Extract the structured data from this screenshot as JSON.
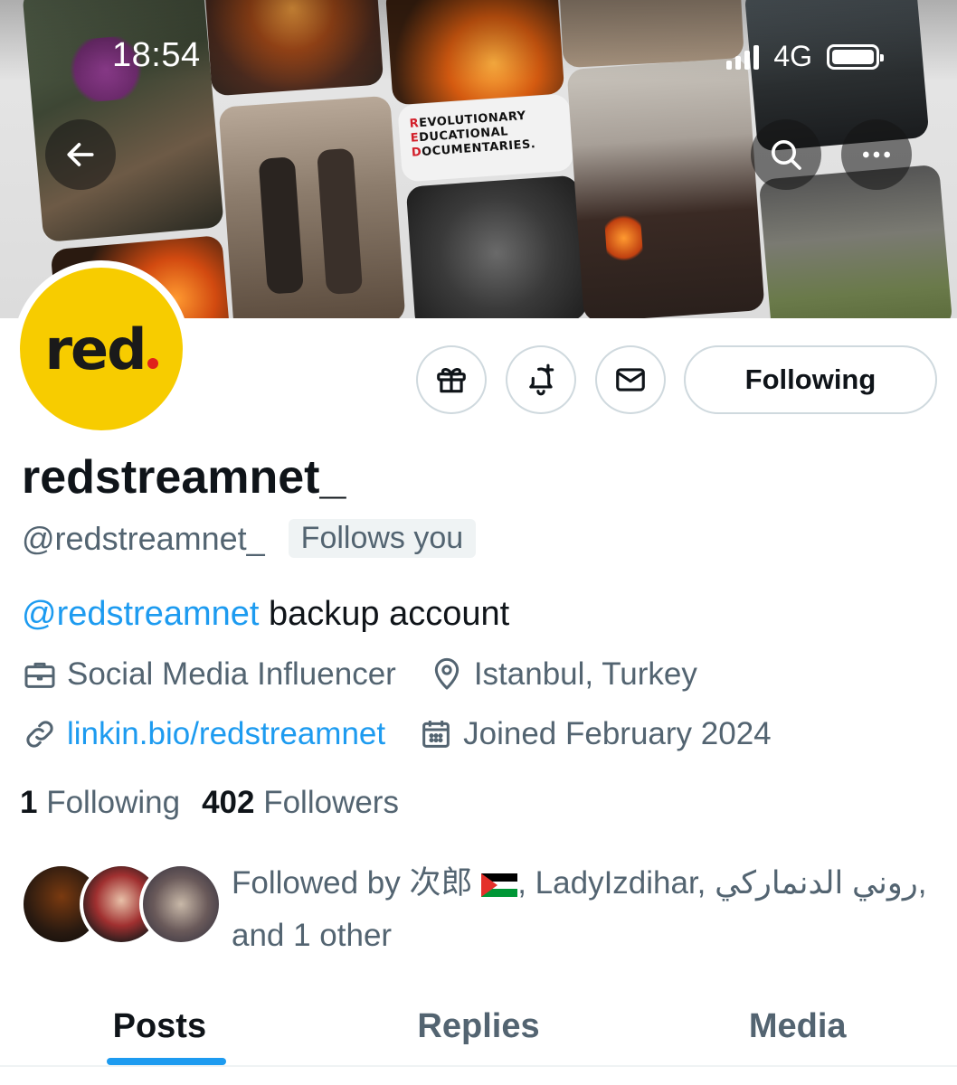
{
  "status_bar": {
    "time": "18:54",
    "network": "4G"
  },
  "banner": {
    "doc_line1_first": "R",
    "doc_line1_rest": "EVOLUTIONARY",
    "doc_line2_first": "E",
    "doc_line2_rest": "DUCATIONAL",
    "doc_line3_first": "D",
    "doc_line3_rest": "OCUMENTARIES."
  },
  "avatar": {
    "text": "red",
    "accent_color": "#f7cc00",
    "dot_color": "#e0221b"
  },
  "actions": {
    "following_label": "Following"
  },
  "profile": {
    "display_name": "redstreamnet_",
    "handle": "@redstreamnet_",
    "follows_you": "Follows you",
    "bio_mention": "@redstreamnet",
    "bio_text": " backup account",
    "category": "Social Media Influencer",
    "location": "Istanbul, Turkey",
    "website": "linkin.bio/redstreamnet",
    "joined": "Joined February 2024"
  },
  "stats": {
    "following_count": "1",
    "following_label": "Following",
    "followers_count": "402",
    "followers_label": "Followers"
  },
  "followed_by": {
    "prefix": "Followed by 次郎 ",
    "middle": ", LadyIzdihar, ",
    "arabic_name": "روني الدنماركي",
    "suffix_comma": ",",
    "line2": "and 1 other"
  },
  "tabs": [
    {
      "label": "Posts",
      "active": true
    },
    {
      "label": "Replies",
      "active": false
    },
    {
      "label": "Media",
      "active": false
    }
  ],
  "colors": {
    "link": "#1d9bf0",
    "secondary_text": "#536471",
    "primary_text": "#0f1419",
    "border": "#cfd9de"
  }
}
